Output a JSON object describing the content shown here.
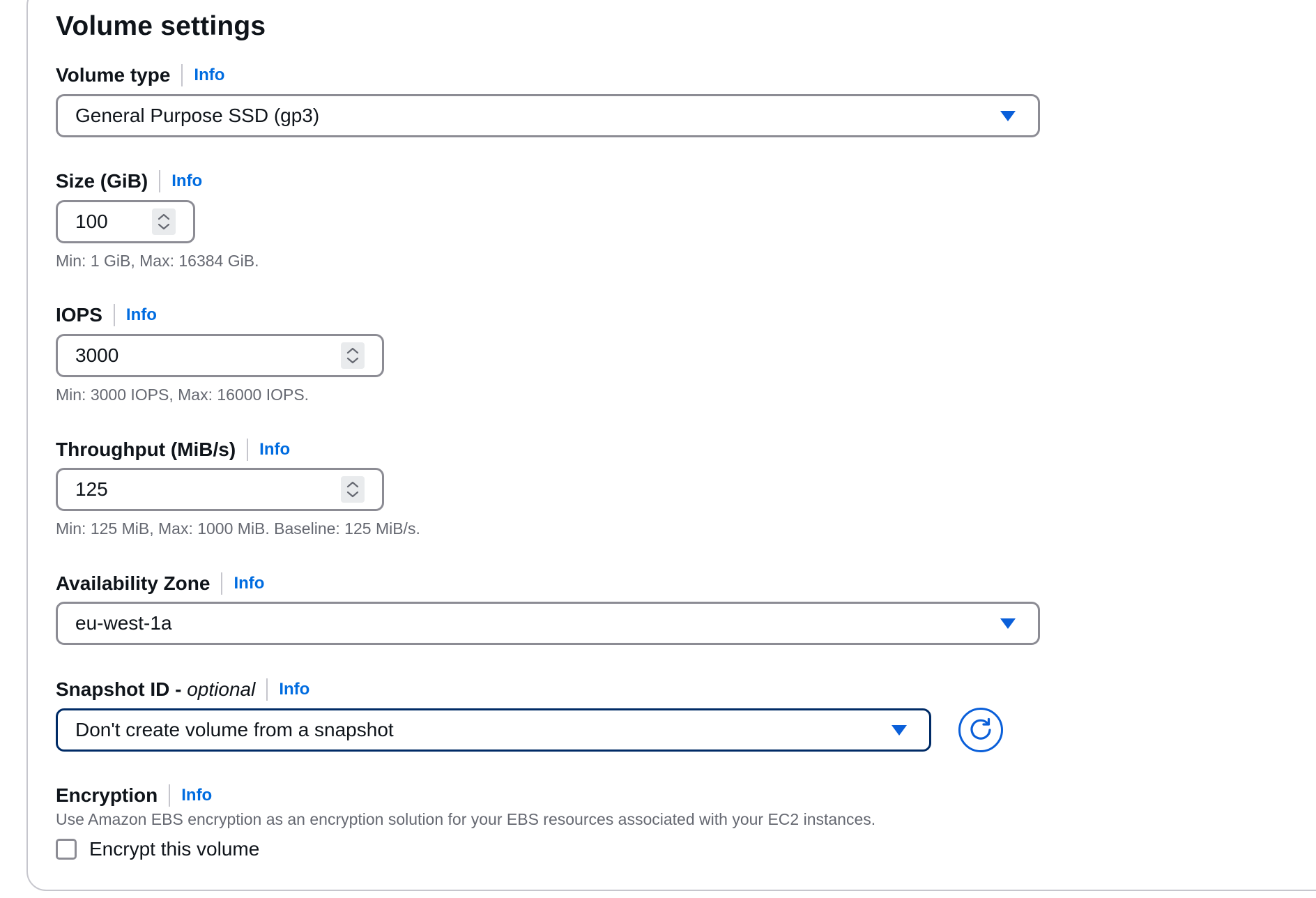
{
  "section": {
    "title": "Volume settings"
  },
  "volume_type": {
    "label": "Volume type",
    "info": "Info",
    "value": "General Purpose SSD (gp3)"
  },
  "size": {
    "label": "Size (GiB)",
    "info": "Info",
    "value": "100",
    "hint": "Min: 1 GiB, Max: 16384 GiB."
  },
  "iops": {
    "label": "IOPS",
    "info": "Info",
    "value": "3000",
    "hint": "Min: 3000 IOPS, Max: 16000 IOPS."
  },
  "throughput": {
    "label": "Throughput (MiB/s)",
    "info": "Info",
    "value": "125",
    "hint": "Min: 125 MiB, Max: 1000 MiB. Baseline: 125 MiB/s."
  },
  "availability_zone": {
    "label": "Availability Zone",
    "info": "Info",
    "value": "eu-west-1a"
  },
  "snapshot": {
    "label": "Snapshot ID",
    "separator": " - ",
    "optional": "optional",
    "info": "Info",
    "value": "Don't create volume from a snapshot",
    "refresh_icon": "refresh-icon"
  },
  "encryption": {
    "label": "Encryption",
    "info": "Info",
    "description": "Use Amazon EBS encryption as an encryption solution for your EBS resources associated with your EC2 instances.",
    "checkbox_label": "Encrypt this volume",
    "checked": false
  },
  "colors": {
    "link": "#006ce0",
    "caret": "#0a5fd9",
    "border": "#8c8c94",
    "focused_border": "#002b66",
    "hint_text": "#656871"
  }
}
